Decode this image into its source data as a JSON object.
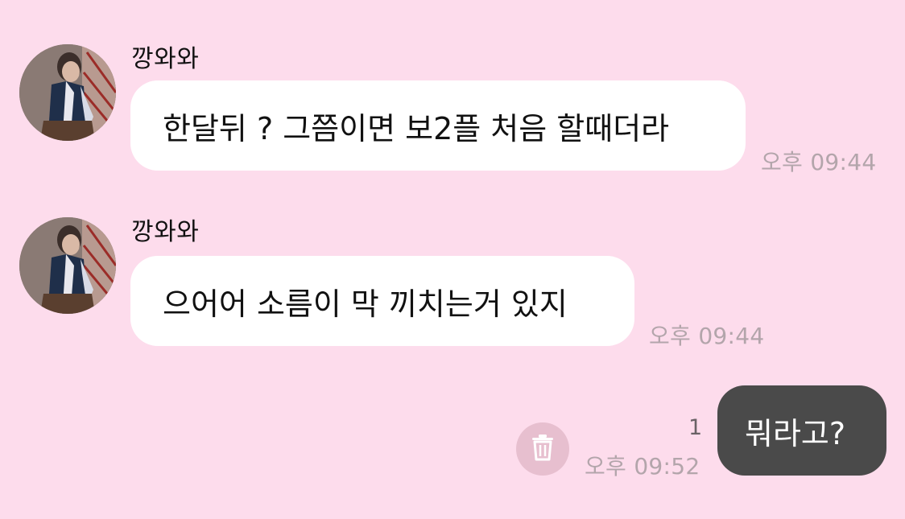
{
  "messages": [
    {
      "sender": "깡와와",
      "text": "한달뒤 ? 그쯤이면 보2플 처음 할때더라",
      "time": "오후 09:44"
    },
    {
      "sender": "깡와와",
      "text": "으어어 소름이 막 끼치는거 있지",
      "time": "오후 09:44"
    }
  ],
  "my_message": {
    "text": "뭐라고?",
    "time": "오후 09:52",
    "unread_count": "1"
  },
  "icons": {
    "delete": "trash-icon",
    "avatar": "profile-photo"
  },
  "colors": {
    "background": "#fddcec",
    "incoming_bubble": "#ffffff",
    "outgoing_bubble": "#4a4a4a",
    "timestamp": "#b3a5ab",
    "delete_button": "#e7bfcf"
  }
}
